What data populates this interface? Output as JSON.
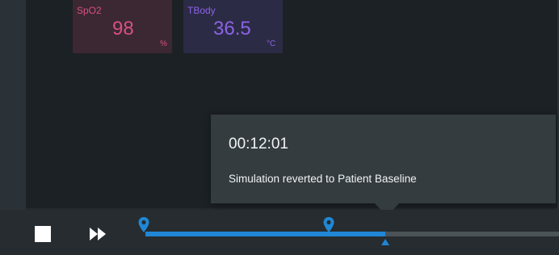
{
  "vitals": [
    {
      "label": "SpO2",
      "value": "98",
      "unit": "%",
      "color": "#d9507f"
    },
    {
      "label": "TBody",
      "value": "36.5",
      "unit": "°C",
      "color": "#8c63e6"
    }
  ],
  "toast": {
    "time": "00:12:01",
    "message": "Simulation reverted to Patient Baseline"
  },
  "timeline": {
    "progress_fraction": 0.58,
    "playhead_fraction": 0.58,
    "markers": [
      "map-pin-icon",
      "map-pin-icon"
    ]
  },
  "controls": {
    "stop_icon": "stop-icon",
    "fast_forward_icon": "fast-forward-icon"
  },
  "colors": {
    "accent": "#1f87d6",
    "spo2": "#d9507f",
    "tbody": "#8c63e6"
  }
}
